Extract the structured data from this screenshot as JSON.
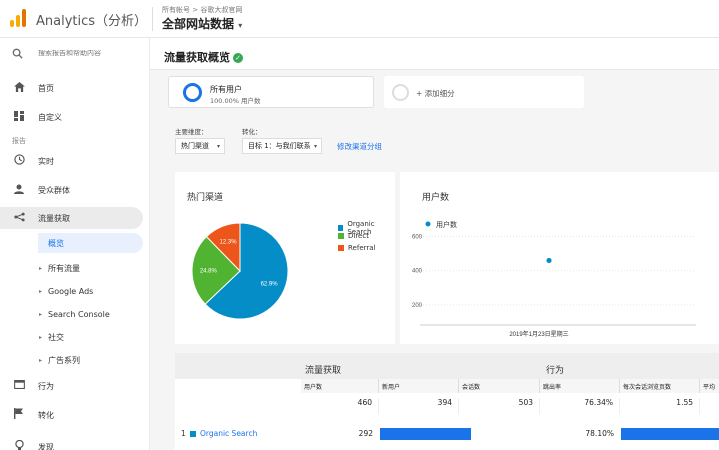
{
  "header": {
    "app_title": "Analytics（分析）",
    "account_path": "所有帐号 > 谷歌大叔官网",
    "view_name": "全部网站数据"
  },
  "sidebar": {
    "search_placeholder": "搜索报告和帮助内容",
    "items": [
      {
        "label": "首页",
        "icon": "home-icon"
      },
      {
        "label": "自定义",
        "icon": "dashboard-icon"
      }
    ],
    "section_label": "报告",
    "reports": [
      {
        "label": "实时",
        "icon": "clock-icon"
      },
      {
        "label": "受众群体",
        "icon": "person-icon"
      },
      {
        "label": "流量获取",
        "icon": "acquisition-icon"
      }
    ],
    "acquisition_sub": [
      {
        "label": "概览"
      },
      {
        "label": "所有流量"
      },
      {
        "label": "Google Ads"
      },
      {
        "label": "Search Console"
      },
      {
        "label": "社交"
      },
      {
        "label": "广告系列"
      }
    ],
    "bottom": [
      {
        "label": "行为",
        "icon": "behavior-icon"
      },
      {
        "label": "转化",
        "icon": "flag-icon"
      },
      {
        "label": "发现",
        "icon": "lightbulb-icon"
      }
    ]
  },
  "main": {
    "page_title": "流量获取概览",
    "segment": {
      "name": "所有用户",
      "pct": "100.00% 用户数"
    },
    "add_segment": "+ 添加细分",
    "primary_dim_label": "主要维度：",
    "primary_dim_value": "热门渠道",
    "conversion_label": "转化：",
    "conversion_value": "目标 1：与我们联系",
    "edit_link": "修改渠道分组",
    "pie_panel_title": "热门渠道",
    "users_panel_title": "用户数",
    "users_legend": "用户数",
    "date_label": "2019年1月23日星期三"
  },
  "chart_data": [
    {
      "type": "pie",
      "title": "热门渠道",
      "categories": [
        "Organic Search",
        "Direct",
        "Referral"
      ],
      "values": [
        62.9,
        24.8,
        12.3
      ],
      "labels": [
        "62.9%",
        "24.8%",
        "12.3%"
      ],
      "colors": [
        "#058dc7",
        "#50b432",
        "#ed561b"
      ],
      "legend": "right"
    },
    {
      "type": "scatter",
      "title": "用户数",
      "series": [
        {
          "name": "用户数",
          "x": [
            "2019年1月23日星期三"
          ],
          "values": [
            460
          ]
        }
      ],
      "yticks": [
        "200",
        "400",
        "600"
      ],
      "ylim": [
        100,
        650
      ],
      "color": "#058dc7"
    }
  ],
  "table": {
    "group1": "流量获取",
    "group2": "行为",
    "columns": [
      "用户数",
      "新用户",
      "会话数",
      "跳出率",
      "每次会话浏览页数",
      "平均"
    ],
    "totals": [
      "460",
      "394",
      "503",
      "76.34%",
      "1.55"
    ],
    "row1": {
      "index": "1",
      "channel": "Organic Search",
      "users": "292",
      "bounce": "78.10%"
    },
    "bar_fraction_sessions": 0.63,
    "bar_fraction_behavior": 0.62
  }
}
